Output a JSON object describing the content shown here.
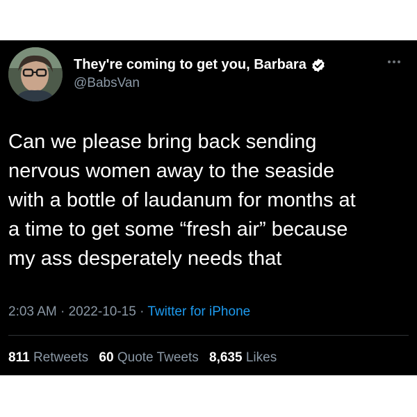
{
  "tweet": {
    "author": {
      "display_name": "They're coming to get you, Barbara",
      "handle": "@BabsVan",
      "verified": true
    },
    "text": "Can we please bring back sending\nnervous women away to the seaside\nwith a bottle of laudanum for months at\na time to get some “fresh air” because\nmy ass desperately needs that",
    "time": "2:03 AM",
    "separator": "·",
    "date": "2022-10-15",
    "source": "Twitter for iPhone",
    "stats": {
      "retweets_count": "811",
      "retweets_label": "Retweets",
      "quotes_count": "60",
      "quotes_label": "Quote Tweets",
      "likes_count": "8,635",
      "likes_label": "Likes"
    }
  },
  "colors": {
    "background": "#000000",
    "text": "#ffffff",
    "secondary": "#8b98a5",
    "link": "#1d9bf0",
    "verified": "#ffffff"
  },
  "icons": [
    "verified-icon",
    "more-icon"
  ]
}
